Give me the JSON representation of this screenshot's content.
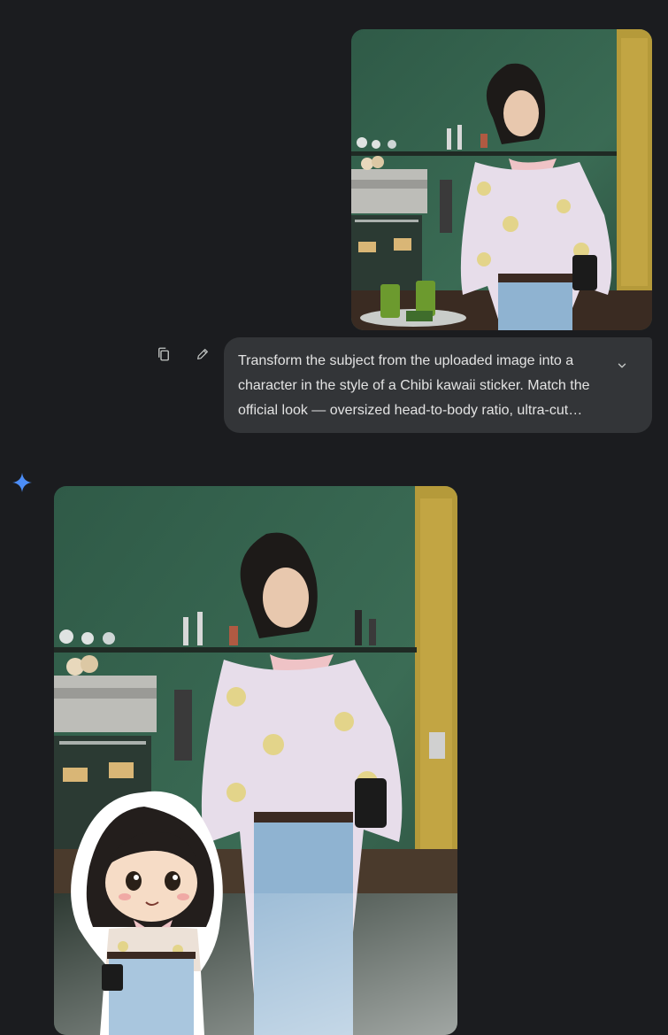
{
  "conversation": {
    "user_message": {
      "image_icon": "uploaded-photo",
      "prompt": "Transform the subject from the uploaded image into a character in the style of a Chibi kawaii sticker. Match the official look — oversized head-to-body ratio, ultra-cut…",
      "actions": {
        "copy_icon": "copy-icon",
        "edit_icon": "edit-pencil-icon",
        "expand_icon": "chevron-down-icon"
      }
    },
    "model_response": {
      "avatar_icon": "gemini-sparkle-icon",
      "image_icon": "generated-image-with-chibi-sticker"
    }
  },
  "colors": {
    "background": "#1b1c1f",
    "bubble": "#333538",
    "text": "#e3e3e3",
    "icon": "#c4c7c5",
    "gemini_blue": "#4c8df6"
  }
}
